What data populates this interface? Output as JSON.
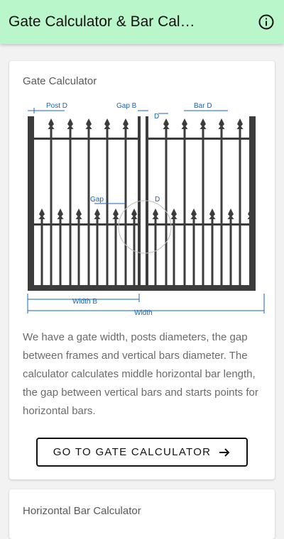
{
  "app": {
    "title": "Gate Calculator & Bar Cal…",
    "info_icon": "info-circle-icon"
  },
  "gate_card": {
    "title": "Gate Calculator",
    "diagram_labels": {
      "post_d": "Post D",
      "gap_b": "Gap B",
      "bar_d": "Bar D",
      "d_top": "D",
      "gap": "Gap",
      "d_mid": "D",
      "width_b": "Width B",
      "width": "Width"
    },
    "description": "We have a gate width, posts diameters, the gap between frames and vertical bars diameter. The calculator calculates middle horizontal bar length, the gap between vertical bars and starts points for horizontal bars.",
    "button_label": "GO TO GATE CALCULATOR",
    "button_icon": "arrow-right-icon"
  },
  "bar_card": {
    "title": "Horizontal Bar Calculator"
  },
  "colors": {
    "appbar": "#b9f6ca",
    "dimension_blue": "#1565c0",
    "gate_metal": "#3c3c3c"
  }
}
